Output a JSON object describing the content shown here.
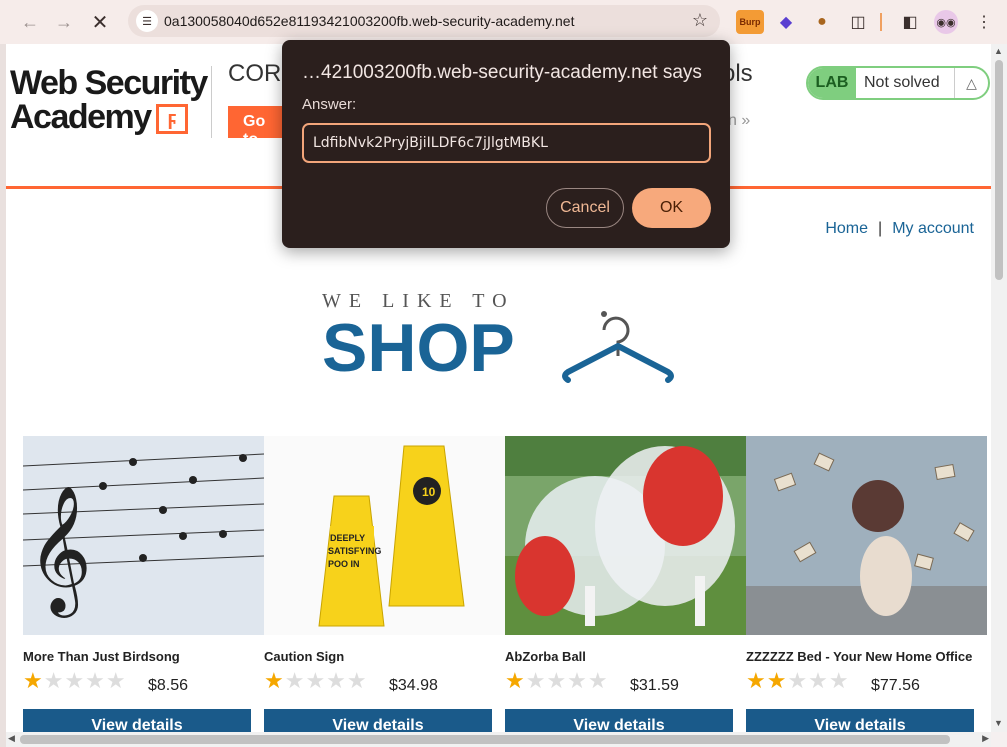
{
  "browser": {
    "url": "0a130058040d652e81193421003200fb.web-security-academy.net",
    "extensions": {
      "burp_label": "Burp"
    }
  },
  "academy": {
    "logo_line1": "Web Security",
    "logo_line2": "Academy",
    "title_fragment_left": "COR",
    "title_fragment_right": "ols",
    "go_to_button": "Go to",
    "link_fragment": "n",
    "lab_badge": {
      "tag": "LAB",
      "status": "Not solved"
    },
    "colors": {
      "accent": "#ff6633",
      "lab_green": "#7fce7f"
    }
  },
  "shop": {
    "nav": {
      "home": "Home",
      "separator": "|",
      "account": "My account"
    },
    "logo_small": "WE LIKE TO",
    "logo_big": "SHOP",
    "brand_color": "#1a6496",
    "products": [
      {
        "name": "More Than Just Birdsong",
        "rating": 1,
        "price": "$8.56",
        "button": "View details",
        "image_icon": "birds-on-wires-image"
      },
      {
        "name": "Caution Sign",
        "rating": 1,
        "price": "$34.98",
        "button": "View details",
        "image_icon": "caution-sign-image"
      },
      {
        "name": "AbZorba Ball",
        "rating": 1,
        "price": "$31.59",
        "button": "View details",
        "image_icon": "zorb-ball-image"
      },
      {
        "name": "ZZZZZZ Bed - Your New Home Office",
        "rating": 2,
        "price": "$77.56",
        "button": "View details",
        "image_icon": "flying-books-bed-image"
      }
    ]
  },
  "dialog": {
    "title": "…421003200fb.web-security-academy.net says",
    "label": "Answer:",
    "input_value": "LdfibNvk2PryjBjiILDF6c7jJlgtMBKL",
    "cancel": "Cancel",
    "ok": "OK",
    "colors": {
      "bg": "#2b1f1d",
      "accent": "#f7a97c"
    }
  }
}
